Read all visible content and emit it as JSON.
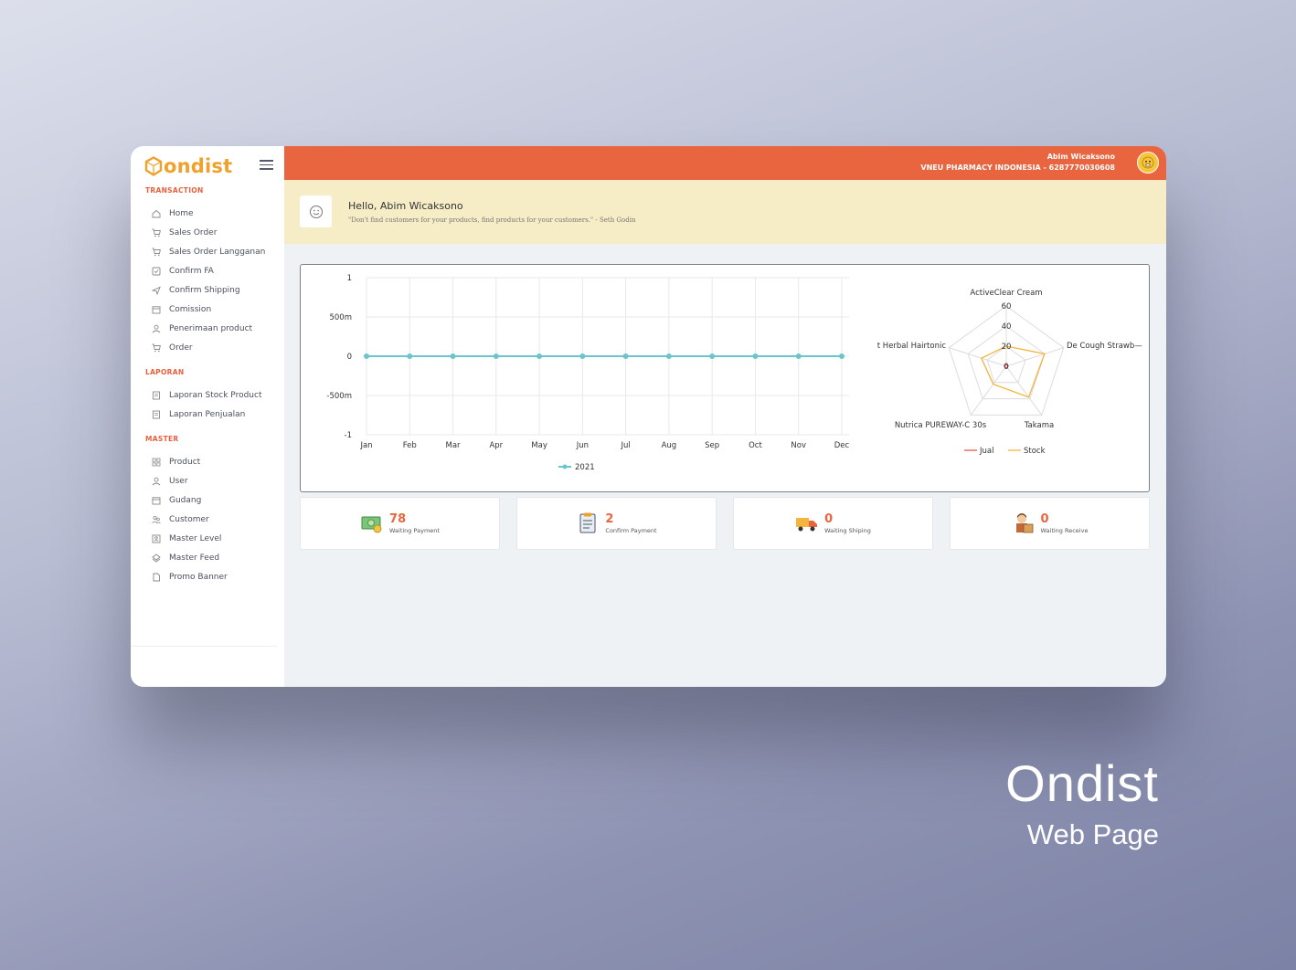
{
  "app": {
    "logo_text": "ondist",
    "accent": "#e8653f",
    "brand_color": "#f0a12b"
  },
  "sidebar": {
    "sections": [
      {
        "title": "TRANSACTION",
        "items": [
          {
            "label": "Home",
            "icon": "home-icon"
          },
          {
            "label": "Sales Order",
            "icon": "cart-icon"
          },
          {
            "label": "Sales Order Langganan",
            "icon": "cart-icon"
          },
          {
            "label": "Confirm FA",
            "icon": "check-square-icon"
          },
          {
            "label": "Confirm Shipping",
            "icon": "send-icon"
          },
          {
            "label": "Comission",
            "icon": "calendar-icon"
          },
          {
            "label": "Penerimaan product",
            "icon": "user-icon"
          },
          {
            "label": "Order",
            "icon": "cart-icon"
          }
        ]
      },
      {
        "title": "LAPORAN",
        "items": [
          {
            "label": "Laporan Stock Product",
            "icon": "report-icon"
          },
          {
            "label": "Laporan Penjualan",
            "icon": "report-icon"
          }
        ]
      },
      {
        "title": "MASTER",
        "items": [
          {
            "label": "Product",
            "icon": "grid-icon"
          },
          {
            "label": "User",
            "icon": "user-icon"
          },
          {
            "label": "Gudang",
            "icon": "calendar-icon"
          },
          {
            "label": "Customer",
            "icon": "users-icon"
          },
          {
            "label": "Master Level",
            "icon": "id-card-icon"
          },
          {
            "label": "Master Feed",
            "icon": "layers-icon"
          },
          {
            "label": "Promo Banner",
            "icon": "file-icon"
          }
        ]
      }
    ]
  },
  "topbar": {
    "user_name": "Abim Wicaksono",
    "company": "VNEU PHARMACY INDONESIA - 6287770030608"
  },
  "greeting": {
    "title": "Hello, Abim Wicaksono",
    "quote": "\"Don't find customers for your products, find products for your customers.\" - Seth Godin"
  },
  "chart_data": [
    {
      "type": "line",
      "x": [
        "Jan",
        "Feb",
        "Mar",
        "Apr",
        "May",
        "Jun",
        "Jul",
        "Aug",
        "Sep",
        "Oct",
        "Nov",
        "Dec"
      ],
      "series": [
        {
          "name": "2021",
          "values": [
            0,
            0,
            0,
            0,
            0,
            0,
            0,
            0,
            0,
            0,
            0,
            0
          ],
          "color": "#6cc4cf"
        }
      ],
      "y_ticks": [
        "1",
        "500m",
        "0",
        "-500m",
        "-1"
      ],
      "ylim": [
        -1,
        1
      ],
      "grid": true,
      "legend": "bottom"
    },
    {
      "type": "radar",
      "axes": [
        "ActiveClear Cream",
        "De Cough Strawb—",
        "Takama",
        "Nutrica PUREWAY-C 30s",
        "t Herbal Hairtonic"
      ],
      "r_ticks": [
        "60",
        "40",
        "20",
        "0"
      ],
      "rlim": [
        0,
        60
      ],
      "series": [
        {
          "name": "Jual",
          "values": [
            2,
            2,
            2,
            2,
            2
          ],
          "color": "#e05a47"
        },
        {
          "name": "Stock",
          "values": [
            20,
            40,
            38,
            22,
            26
          ],
          "color": "#f3b33d"
        }
      ],
      "legend": "bottom"
    }
  ],
  "stats": [
    {
      "value": "78",
      "label": "Waiting Payment",
      "icon": "money-icon"
    },
    {
      "value": "2",
      "label": "Confirm Payment",
      "icon": "clipboard-icon"
    },
    {
      "value": "0",
      "label": "Waiting Shiping",
      "icon": "truck-icon"
    },
    {
      "value": "0",
      "label": "Waiting Receive",
      "icon": "receive-icon"
    }
  ],
  "caption": {
    "title": "Ondist",
    "subtitle": "Web Page"
  }
}
